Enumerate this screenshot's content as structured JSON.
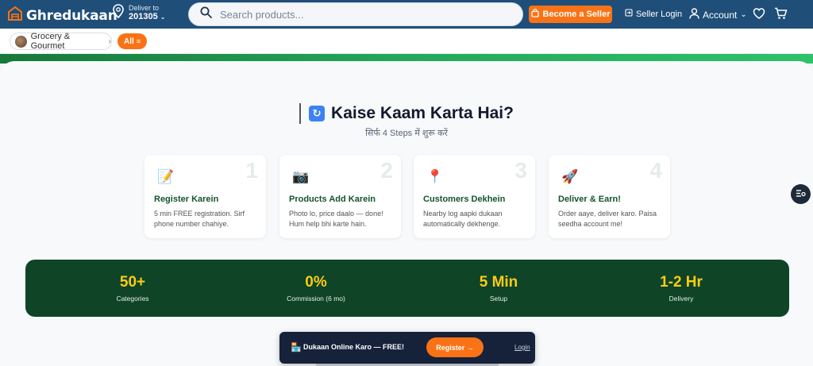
{
  "header": {
    "logo_text": "Ghredukaan",
    "deliver_label": "Deliver to",
    "deliver_pincode": "201305",
    "search_placeholder": "Search products...",
    "become_seller_label": "Become a Seller",
    "seller_login_label": "Seller Login",
    "account_label": "Account"
  },
  "subnav": {
    "category_label": "Grocery & Gourmet",
    "all_label": "All"
  },
  "section": {
    "title": "Kaise Kaam Karta Hai?",
    "subtitle": "सिर्फ 4 Steps में शुरू करें",
    "steps": [
      {
        "num": "1",
        "icon": "📝",
        "title": "Register Karein",
        "desc": "5 min FREE registration. Sirf phone number chahiye."
      },
      {
        "num": "2",
        "icon": "📷",
        "title": "Products Add Karein",
        "desc": "Photo lo, price daalo — done! Hum help bhi karte hain."
      },
      {
        "num": "3",
        "icon": "📍",
        "title": "Customers Dekhein",
        "desc": "Nearby log aapki dukaan automatically dekhenge."
      },
      {
        "num": "4",
        "icon": "🚀",
        "title": "Deliver & Earn!",
        "desc": "Order aaye, deliver karo. Paisa seedha account me!"
      }
    ]
  },
  "stats": [
    {
      "value": "50+",
      "label": "Categories"
    },
    {
      "value": "0%",
      "label": "Commission (6 mo)"
    },
    {
      "value": "5 Min",
      "label": "Setup"
    },
    {
      "value": "1-2 Hr",
      "label": "Delivery"
    }
  ],
  "bottom_bar": {
    "icon": "🏪",
    "text": "Dukaan Online Karo — FREE!",
    "register_label": "Register →",
    "login_label": "Login"
  },
  "colors": {
    "header_bg": "#1f4e79",
    "accent": "#f97316",
    "stats_bg": "#0f4427",
    "stat_value": "#facc15"
  }
}
